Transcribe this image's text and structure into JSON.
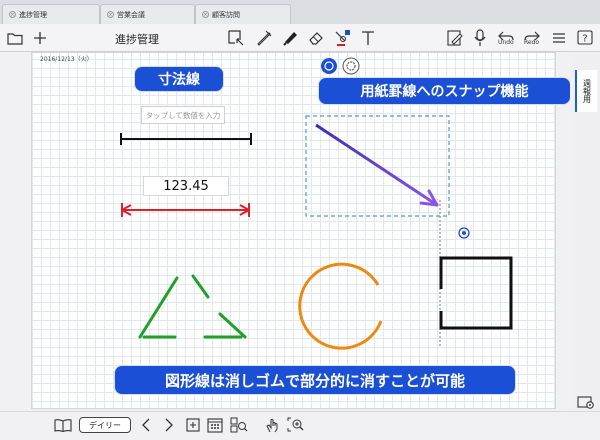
{
  "tabs": [
    {
      "label": "進捗管理"
    },
    {
      "label": "営業会議"
    },
    {
      "label": "顧客訪問"
    }
  ],
  "toolbar": {
    "title": "進捗管理",
    "undo_label": "Undo",
    "redo_label": "Redo"
  },
  "sidebar": {
    "tab_label": "週報用"
  },
  "page": {
    "date": "2016/12/13（火）",
    "callouts": {
      "dimension": "寸法線",
      "snap": "用紙罫線へのスナップ機能",
      "erase": "図形線は消しゴムで部分的に消すことが可能"
    },
    "input_placeholder": "タップして数値を入力",
    "dimension_value": "123.45"
  },
  "bottom": {
    "daily_label": "デイリー"
  },
  "colors": {
    "accent_blue": "#1a4fd6",
    "arrow_purple": "#6a3fe0",
    "dim_red": "#e01f2a",
    "triangle_green": "#1ea12a",
    "circle_orange": "#ec8a12"
  },
  "icons": [
    "folder-icon",
    "plus-icon",
    "lasso-icon",
    "pen-icon",
    "marker-icon",
    "eraser-icon",
    "shape-icon",
    "text-icon",
    "edit-doc-icon",
    "mic-icon",
    "undo-icon",
    "redo-icon",
    "list-icon",
    "menu-icon",
    "help-icon",
    "book-icon",
    "chevron-left-icon",
    "chevron-right-icon",
    "add-page-icon",
    "calendar-icon",
    "page-search-icon",
    "zoom-window-icon",
    "settings-icon"
  ]
}
